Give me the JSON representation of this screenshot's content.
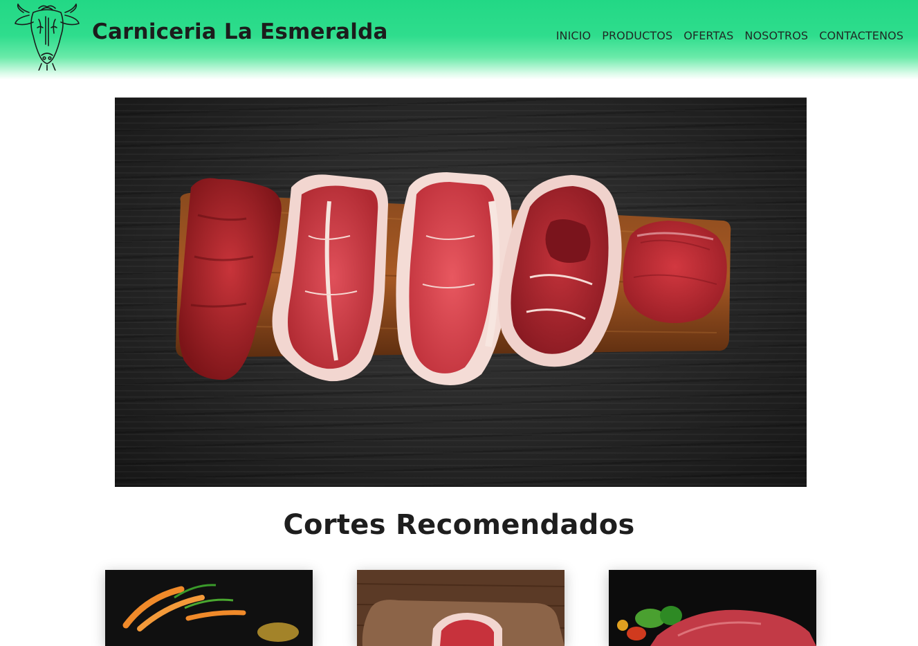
{
  "header": {
    "brand": "Carniceria La Esmeralda",
    "logo_icon": "cow-head-logo-icon",
    "nav": [
      {
        "label": "INICIO"
      },
      {
        "label": "PRODUCTOS"
      },
      {
        "label": "OFERTAS"
      },
      {
        "label": "NOSOTROS"
      },
      {
        "label": "CONTACTENOS"
      }
    ]
  },
  "hero": {
    "image": "raw-beef-cuts-on-wooden-board"
  },
  "recommended": {
    "title": "Cortes Recomendados",
    "cards": [
      {
        "image": "meat-with-carrots-and-greens"
      },
      {
        "image": "beef-cut-on-wooden-board"
      },
      {
        "image": "beef-with-peppers"
      }
    ]
  },
  "colors": {
    "header_green": "#22d885",
    "text_dark": "#1c1c1c"
  }
}
